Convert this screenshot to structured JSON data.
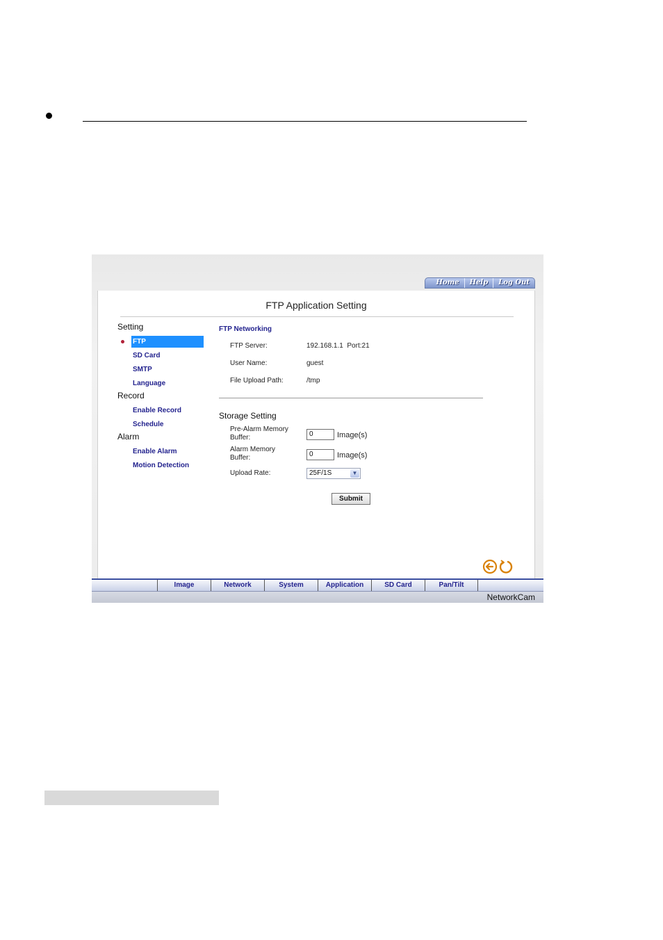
{
  "top_nav": [
    "Home",
    "Help",
    "Log Out"
  ],
  "page_title": "FTP Application Setting",
  "sidebar": {
    "setting_label": "Setting",
    "setting_items": [
      "FTP",
      "SD Card",
      "SMTP",
      "Language"
    ],
    "record_label": "Record",
    "record_items": [
      "Enable Record",
      "Schedule"
    ],
    "alarm_label": "Alarm",
    "alarm_items": [
      "Enable Alarm",
      "Motion Detection"
    ]
  },
  "ftp_networking": {
    "title": "FTP Networking",
    "server_label": "FTP Server:",
    "server_value": "192.168.1.1  Port:21",
    "user_label": "User Name:",
    "user_value": "guest",
    "path_label": "File Upload Path:",
    "path_value": "/tmp"
  },
  "storage": {
    "title": "Storage Setting",
    "pre_alarm_label": "Pre-Alarm Memory Buffer:",
    "pre_alarm_value": "0",
    "alarm_label": "Alarm Memory Buffer:",
    "alarm_value": "0",
    "unit": "Image(s)",
    "upload_rate_label": "Upload Rate:",
    "upload_rate_value": "25F/1S"
  },
  "submit_label": "Submit",
  "bottom_tabs": [
    "Image",
    "Network",
    "System",
    "Application",
    "SD Card",
    "Pan/Tilt"
  ],
  "brand": "NetworkCam",
  "icons": [
    "back-arrow-icon",
    "refresh-icon"
  ],
  "colors": {
    "link_blue": "#23238e",
    "active_blue": "#1e90ff",
    "nav_bar": "#3b4fa0"
  }
}
